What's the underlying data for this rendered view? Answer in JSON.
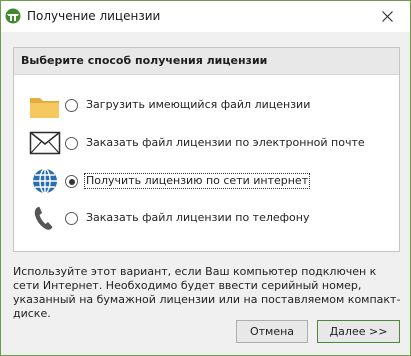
{
  "window": {
    "title": "Получение лицензии",
    "icons": {
      "app": "license-app-icon",
      "close": "close-icon"
    }
  },
  "group": {
    "title": "Выберите способ получения лицензии"
  },
  "options": [
    {
      "label": "Загрузить имеющийся файл лицензии",
      "icon": "folder-icon",
      "selected": false
    },
    {
      "label": "Заказать файл лицензии по электронной почте",
      "icon": "envelope-icon",
      "selected": false
    },
    {
      "label": "Получить лицензию по сети интернет",
      "icon": "globe-icon",
      "selected": true
    },
    {
      "label": "Заказать файл лицензии по телефону",
      "icon": "phone-icon",
      "selected": false
    }
  ],
  "info": {
    "text": "Используйте этот вариант, если Ваш компьютер подключен к сети Интернет. Необходимо будет ввести серийный номер, указанный на бумажной лицензии или на поставляемом компакт-диске."
  },
  "buttons": {
    "cancel": "Отмена",
    "next": "Далее >>"
  },
  "colors": {
    "accent": "#4a8a3a",
    "icon_blue": "#2a6fb0",
    "folder": "#f2c45a"
  }
}
